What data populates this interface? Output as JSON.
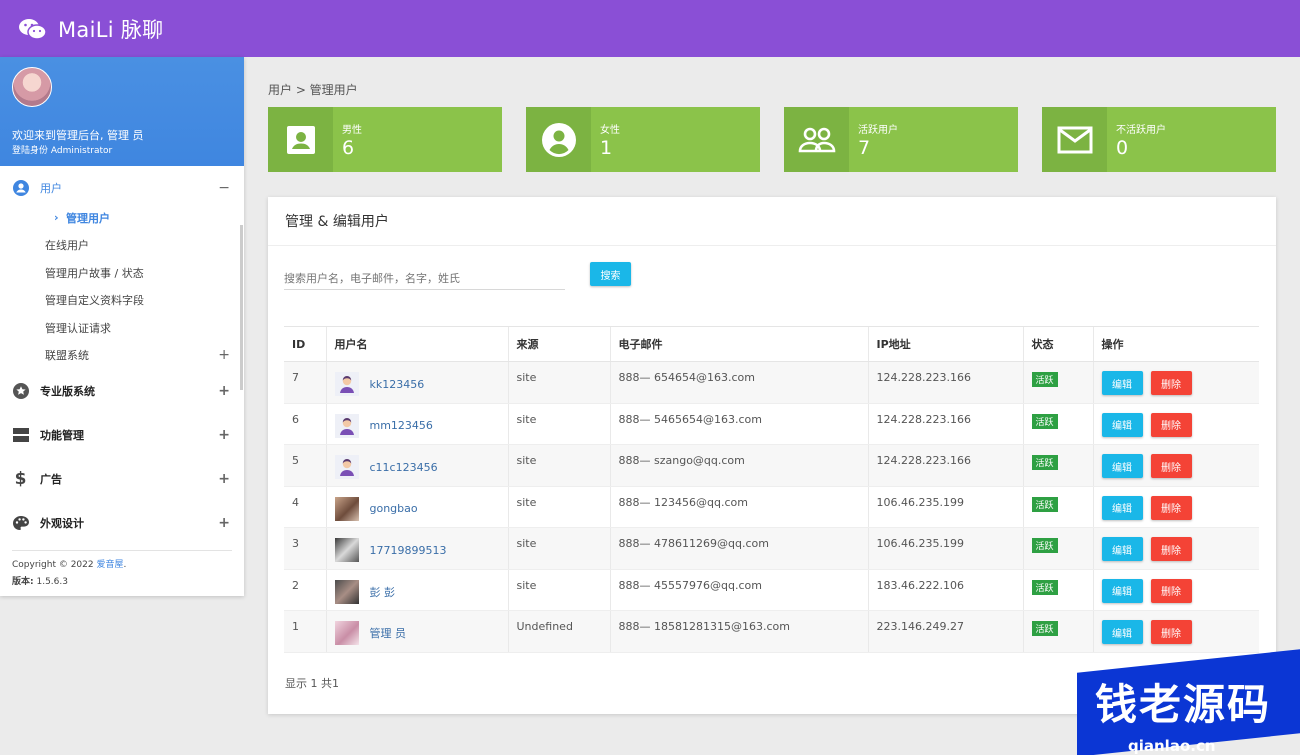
{
  "app": {
    "brand": "MaiLi 脉聊"
  },
  "sidebar": {
    "welcome": "欢迎来到管理后台, 管理 员",
    "identity": "登陆身份 Administrator",
    "menu": {
      "users": {
        "label": "用户",
        "toggle": "−"
      },
      "sub": {
        "manage_users": "管理用户",
        "online_users": "在线用户",
        "user_stories": "管理用户故事 / 状态",
        "custom_fields": "管理自定义资料字段",
        "verification": "管理认证请求",
        "affiliate": "联盟系统"
      },
      "pro": "专业版系统",
      "features": "功能管理",
      "ads": "广告",
      "appearance": "外观设计",
      "plus": "+"
    },
    "footer": {
      "copyright": "Copyright © 2022",
      "site_link": "爱音屋",
      "version_label": "版本:",
      "version": "1.5.6.3"
    }
  },
  "breadcrumb": "用户 > 管理用户",
  "stats": [
    {
      "label": "男性",
      "value": "6"
    },
    {
      "label": "女性",
      "value": "1"
    },
    {
      "label": "活跃用户",
      "value": "7"
    },
    {
      "label": "不活跃用户",
      "value": "0"
    }
  ],
  "card": {
    "title": "管理 & 编辑用户",
    "search_placeholder": "搜索用户名，电子邮件，名字，姓氏",
    "search_button": "搜索",
    "columns": [
      "ID",
      "用户名",
      "来源",
      "电子邮件",
      "IP地址",
      "状态",
      "操作"
    ],
    "rows": [
      {
        "id": "7",
        "username": "kk123456",
        "source": "site",
        "email": "888— 654654@163.com",
        "ip": "124.228.223.166",
        "status": "活跃"
      },
      {
        "id": "6",
        "username": "mm123456",
        "source": "site",
        "email": "888— 5465654@163.com",
        "ip": "124.228.223.166",
        "status": "活跃"
      },
      {
        "id": "5",
        "username": "c11c123456",
        "source": "site",
        "email": "888— szango@qq.com",
        "ip": "124.228.223.166",
        "status": "活跃"
      },
      {
        "id": "4",
        "username": "gongbao",
        "source": "site",
        "email": "888— 123456@qq.com",
        "ip": "106.46.235.199",
        "status": "活跃"
      },
      {
        "id": "3",
        "username": "17719899513",
        "source": "site",
        "email": "888— 478611269@qq.com",
        "ip": "106.46.235.199",
        "status": "活跃"
      },
      {
        "id": "2",
        "username": "彭 彭",
        "source": "site",
        "email": "888— 45557976@qq.com",
        "ip": "183.46.222.106",
        "status": "活跃"
      },
      {
        "id": "1",
        "username": "管理 员",
        "source": "Undefined",
        "email": "888— 18581281315@163.com",
        "ip": "223.146.249.27",
        "status": "活跃"
      }
    ],
    "edit_label": "编辑",
    "delete_label": "删除",
    "pagination": "显示 1 共1"
  },
  "watermark": {
    "text": "钱老源码",
    "url": "qianlao.cn"
  },
  "colors": {
    "topbar": "#8a4fd6",
    "profile": "#4a90e2",
    "stat_card": "#8bc34a",
    "stat_icon": "#7cb342",
    "primary_button": "#1ab7e8",
    "danger_button": "#f44336",
    "status_badge": "#2ea043",
    "watermark": "#0b36d4"
  }
}
